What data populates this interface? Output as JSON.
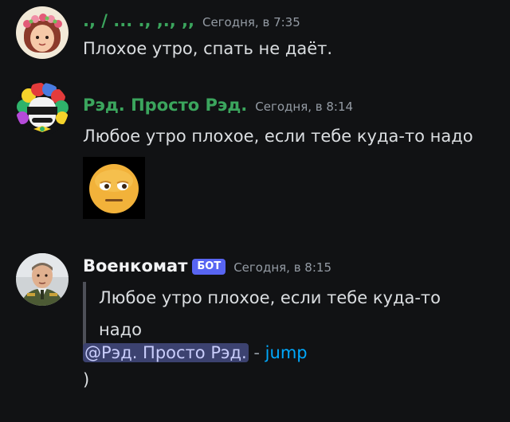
{
  "messages": [
    {
      "author": "., / ... ., ,., ,,",
      "author_color": "#3ba55d",
      "timestamp": "Сегодня, в 7:35",
      "text": "Плохое утро, спать не даёт."
    },
    {
      "author": "Рэд. Просто Рэд.",
      "author_color": "#3ba55d",
      "timestamp": "Сегодня, в 8:14",
      "text": "Любое утро плохое, если тебе куда-то надо",
      "attachment_icon": "sleepy-face-emoji-icon"
    },
    {
      "author": "Военкомат",
      "author_color": "#f2f3f5",
      "badge": "БОТ",
      "timestamp": "Сегодня, в 8:15",
      "quote_line1": "Любое утро плохое, если тебе куда-то",
      "quote_line2": "надо",
      "mention": "@Рэд. Просто Рэд.",
      "separator": "-",
      "jump_label": "jump",
      "trailing": ")"
    }
  ],
  "colors": {
    "background": "#111214",
    "bot_badge": "#5865f2",
    "link": "#00a8fc"
  }
}
